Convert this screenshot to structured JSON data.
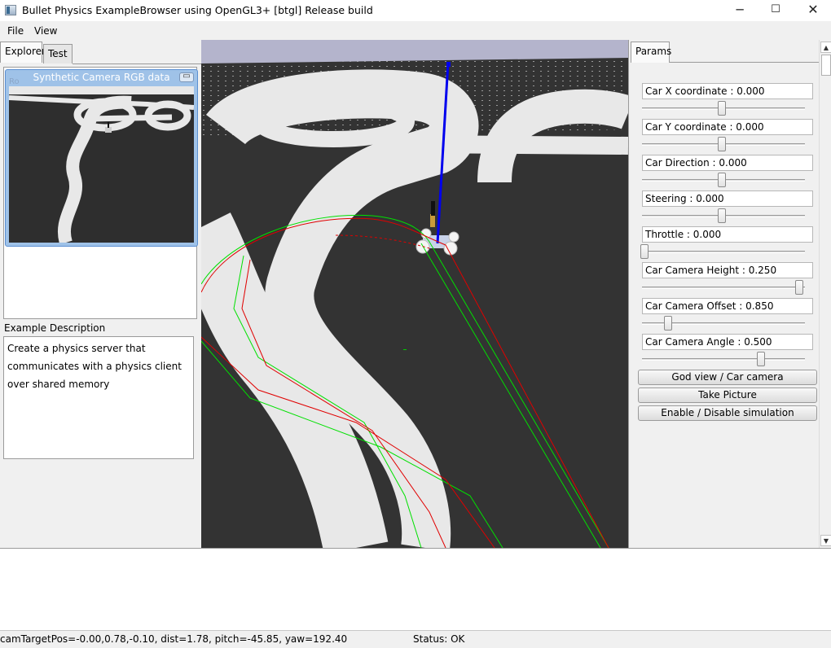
{
  "window": {
    "title": "Bullet Physics ExampleBrowser using OpenGL3+ [btgl] Release build",
    "minimize_glyph": "─",
    "maximize_glyph": "☐",
    "close_glyph": "✕"
  },
  "menu": {
    "file": "File",
    "view": "View"
  },
  "left": {
    "tabs": [
      "Explorer",
      "Test"
    ],
    "camera_window_title": "Synthetic Camera RGB data",
    "camera_ghost_text": "Ro",
    "camera_close_glyph": "▭",
    "description_label": "Example Description",
    "description_lines": [
      "Create a physics server that",
      "communicates with a physics client",
      "over shared memory"
    ]
  },
  "params": {
    "tab": "Params",
    "fields": [
      {
        "label": "Car X coordinate : 0.000",
        "value": 0.5
      },
      {
        "label": "Car Y coordinate : 0.000",
        "value": 0.5
      },
      {
        "label": "Car Direction : 0.000",
        "value": 0.5
      },
      {
        "label": "Steering : 0.000",
        "value": 0.5
      },
      {
        "label": "Throttle : 0.000",
        "value": 0.0
      },
      {
        "label": "Car Camera Height : 0.250",
        "value": 1.0
      },
      {
        "label": "Car Camera Offset : 0.850",
        "value": 0.15
      },
      {
        "label": "Car Camera Angle : 0.500",
        "value": 0.75
      }
    ],
    "buttons": [
      "God view / Car camera",
      "Take Picture",
      "Enable / Disable simulation"
    ],
    "scroll_up_glyph": "▲",
    "scroll_down_glyph": "▼"
  },
  "status": {
    "camera": "camTargetPos=-0.00,0.78,-0.10, dist=1.78, pitch=-45.85, yaw=192.40",
    "state": "Status: OK"
  },
  "colors": {
    "sky": "#b4b4cc",
    "ground": "#333333",
    "track": "#e8e8e8",
    "axis_blue": "#0000ee",
    "path_red": "#e00000",
    "path_green": "#00e000"
  }
}
